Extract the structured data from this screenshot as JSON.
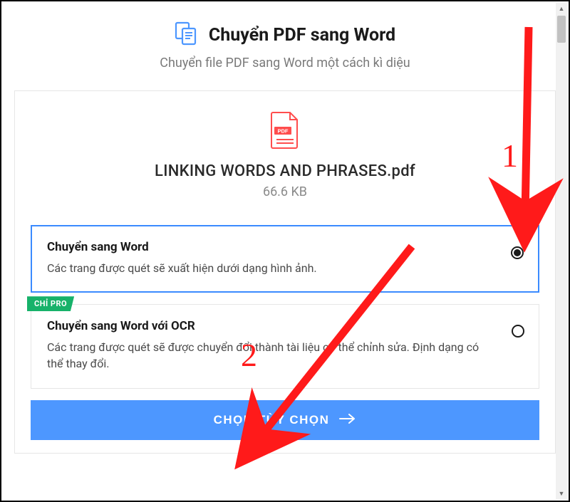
{
  "header": {
    "title": "Chuyển PDF sang Word",
    "subtitle": "Chuyển file PDF sang Word một cách kì diệu"
  },
  "file": {
    "name": "LINKING WORDS AND PHRASES.pdf",
    "size": "66.6 KB",
    "icon_badge": "PDF"
  },
  "options": [
    {
      "title": "Chuyển sang Word",
      "desc": "Các trang được quét sẽ xuất hiện dưới dạng hình ảnh.",
      "selected": true
    },
    {
      "title": "Chuyển sang Word với OCR",
      "desc": "Các trang được quét sẽ được chuyển đổi thành tài liệu có thể chỉnh sửa. Định dạng có thể thay đổi.",
      "selected": false,
      "pro_badge": "CHỈ PRO"
    }
  ],
  "cta_label": "CHỌN TÙY CHỌN",
  "annotations": {
    "num1": "1",
    "num2": "2"
  },
  "colors": {
    "accent": "#4d97ff",
    "outline_selected": "#3b8bff",
    "pro_badge": "#17b26a",
    "annotation": "#ff1a1a",
    "pdf_icon": "#ff4d4d"
  }
}
